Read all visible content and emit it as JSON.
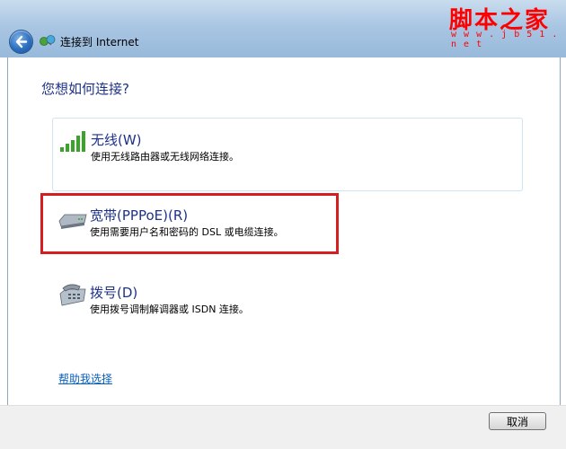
{
  "window": {
    "title": "连接到 Internet"
  },
  "watermark": {
    "text": "脚本之家",
    "url": "w w w . j b 5 1 . n e t"
  },
  "main": {
    "question": "您想如何连接?",
    "options": [
      {
        "title": "无线(W)",
        "description": "使用无线路由器或无线网络连接。",
        "icon": "wireless-signal-icon"
      },
      {
        "title": "宽带(PPPoE)(R)",
        "description": "使用需要用户名和密码的 DSL 或电缆连接。",
        "icon": "modem-icon"
      },
      {
        "title": "拨号(D)",
        "description": "使用拨号调制解调器或 ISDN 连接。",
        "icon": "phone-modem-icon"
      }
    ],
    "help_link": "帮助我选择"
  },
  "footer": {
    "cancel_label": "取消"
  },
  "colors": {
    "heading_blue": "#1e3287",
    "link_blue": "#0b5fb8",
    "highlight_red": "#d51d22",
    "wireless_green": "#3aa32a"
  }
}
